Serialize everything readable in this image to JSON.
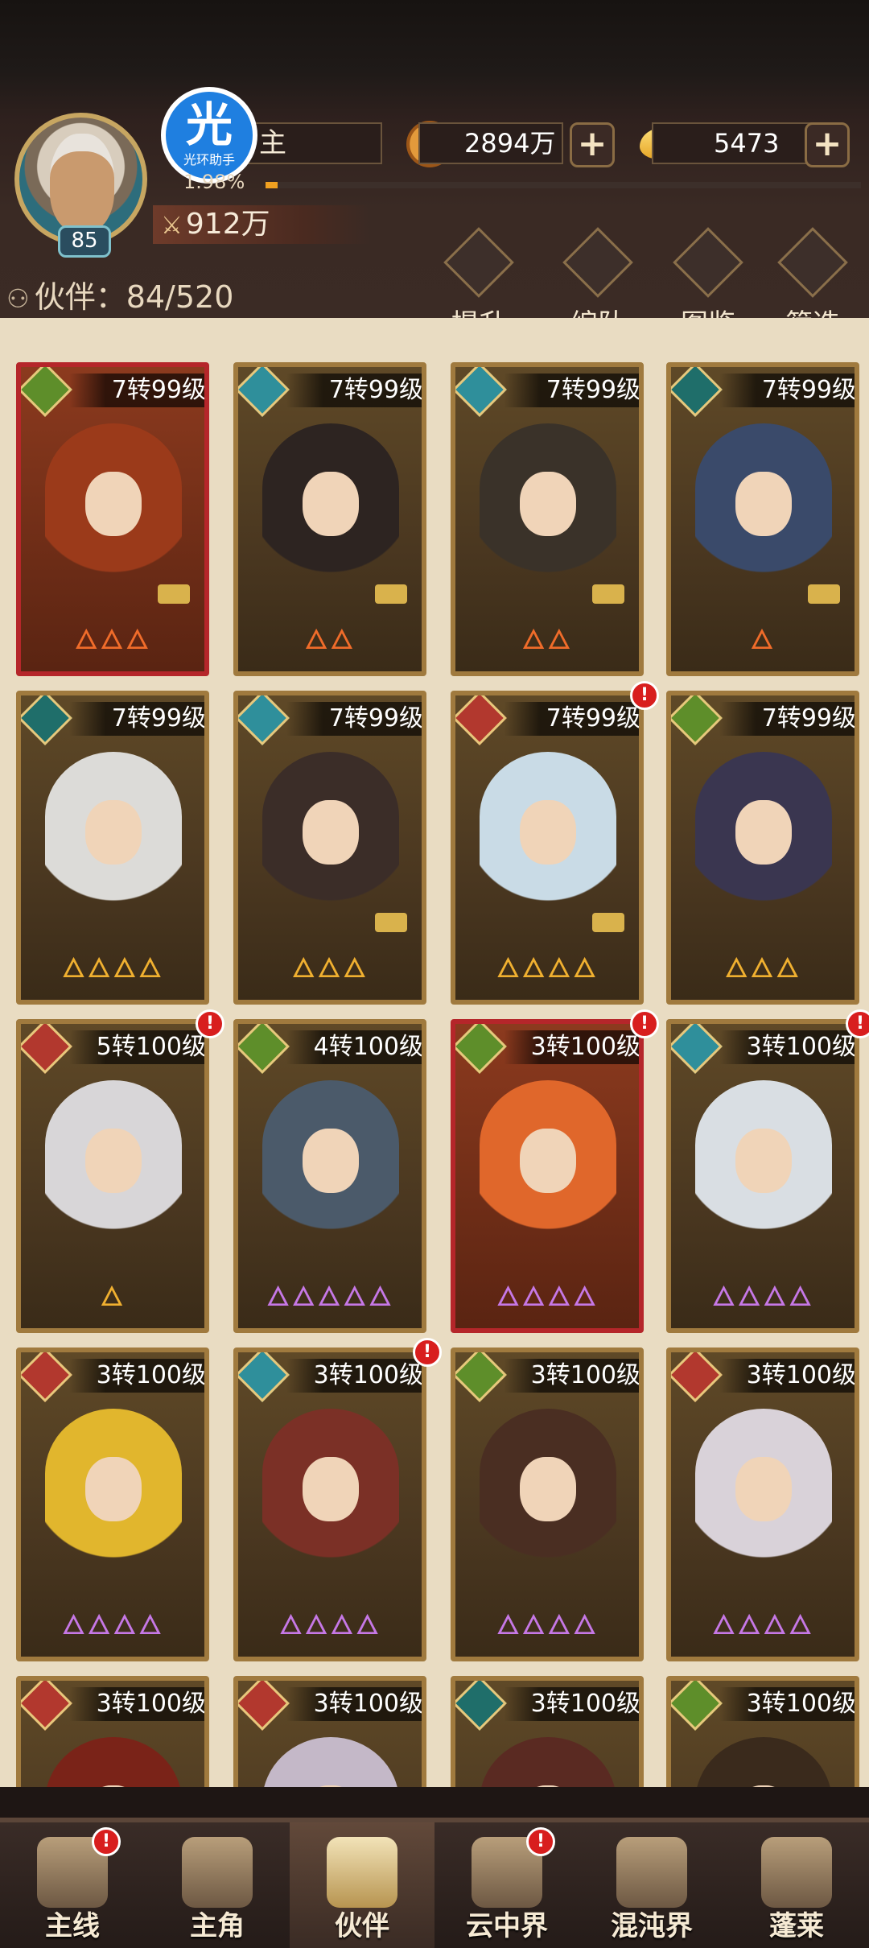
{
  "header": {
    "player_name": "主",
    "level": "85",
    "exp_percent": "1.98%",
    "exp_fraction": 0.0198,
    "power": "912万",
    "coins": "2894万",
    "gold": "5473",
    "helper_glyph": "光",
    "helper_label": "光环助手",
    "companions_label": "伙伴：84/520",
    "tools": [
      {
        "label": "提升",
        "icon": "upgrade-icon"
      },
      {
        "label": "编队",
        "icon": "formation-flag-icon"
      },
      {
        "label": "图鉴",
        "icon": "codex-scroll-icon"
      },
      {
        "label": "筛选",
        "icon": "filter-icon"
      }
    ]
  },
  "cards": [
    {
      "rank": "7转99级",
      "frame": "red",
      "stars": "🜂🜂🜂",
      "star_color": "orange",
      "star_count": 3,
      "locked": true,
      "alert": false,
      "element_color": "#5e8e2a",
      "art": "#9b3a1a"
    },
    {
      "rank": "7转99级",
      "frame": "gold",
      "stars": "🜂🜂",
      "star_color": "orange",
      "star_count": 2,
      "locked": true,
      "alert": false,
      "element_color": "#2f8f9b",
      "art": "#2d2421"
    },
    {
      "rank": "7转99级",
      "frame": "gold",
      "stars": "🜂🜂",
      "star_color": "orange",
      "star_count": 2,
      "locked": true,
      "alert": false,
      "element_color": "#2f8f9b",
      "art": "#3a3229"
    },
    {
      "rank": "7转99级",
      "frame": "gold",
      "stars": "🜂",
      "star_color": "orange",
      "star_count": 1,
      "locked": true,
      "alert": false,
      "element_color": "#1f6e6a",
      "art": "#3a4a6a"
    },
    {
      "rank": "7转99级",
      "frame": "gold",
      "stars": "🜂🜂🜂🜂",
      "star_color": "gold",
      "star_count": 4,
      "locked": false,
      "alert": false,
      "element_color": "#1f6e6a",
      "art": "#dcdbd8"
    },
    {
      "rank": "7转99级",
      "frame": "gold",
      "stars": "🜂🜂🜂",
      "star_color": "gold",
      "star_count": 3,
      "locked": true,
      "alert": false,
      "element_color": "#2f8f9b",
      "art": "#3b2d28"
    },
    {
      "rank": "7转99级",
      "frame": "gold",
      "stars": "🜂🜂🜂🜂",
      "star_color": "gold",
      "star_count": 4,
      "locked": true,
      "alert": true,
      "element_color": "#b2382e",
      "art": "#c9dbe6"
    },
    {
      "rank": "7转99级",
      "frame": "gold",
      "stars": "🜂🜂🜂",
      "star_color": "gold",
      "star_count": 3,
      "locked": false,
      "alert": false,
      "element_color": "#5e8e2a",
      "art": "#3a3650"
    },
    {
      "rank": "5转100级",
      "frame": "gold",
      "stars": "🜂",
      "star_color": "gold",
      "star_count": 1,
      "locked": false,
      "alert": true,
      "element_color": "#b2382e",
      "art": "#d8d6d8"
    },
    {
      "rank": "4转100级",
      "frame": "gold",
      "stars": "🜂🜂🜂🜂🜂",
      "star_color": "purple",
      "star_count": 5,
      "locked": false,
      "alert": false,
      "element_color": "#5e8e2a",
      "art": "#4b5a6a"
    },
    {
      "rank": "3转100级",
      "frame": "red",
      "stars": "🜂🜂🜂🜂",
      "star_color": "purple",
      "star_count": 4,
      "locked": false,
      "alert": true,
      "element_color": "#5e8e2a",
      "art": "#e0672b"
    },
    {
      "rank": "3转100级",
      "frame": "gold",
      "stars": "🜂🜂🜂🜂",
      "star_color": "purple",
      "star_count": 4,
      "locked": false,
      "alert": true,
      "element_color": "#2f8f9b",
      "art": "#d9dee3"
    },
    {
      "rank": "3转100级",
      "frame": "gold",
      "stars": "🜂🜂🜂🜂",
      "star_color": "purple",
      "star_count": 4,
      "locked": false,
      "alert": false,
      "element_color": "#b2382e",
      "art": "#e1b62d"
    },
    {
      "rank": "3转100级",
      "frame": "gold",
      "stars": "🜂🜂🜂🜂",
      "star_color": "purple",
      "star_count": 4,
      "locked": false,
      "alert": true,
      "element_color": "#2f8f9b",
      "art": "#7b3026"
    },
    {
      "rank": "3转100级",
      "frame": "gold",
      "stars": "🜂🜂🜂🜂",
      "star_color": "purple",
      "star_count": 4,
      "locked": false,
      "alert": false,
      "element_color": "#5e8e2a",
      "art": "#4a2e22"
    },
    {
      "rank": "3转100级",
      "frame": "gold",
      "stars": "🜂🜂🜂🜂",
      "star_color": "purple",
      "star_count": 4,
      "locked": false,
      "alert": false,
      "element_color": "#b2382e",
      "art": "#d9d2d9"
    },
    {
      "rank": "3转100级",
      "frame": "gold",
      "stars": "",
      "star_color": "purple",
      "star_count": 0,
      "locked": false,
      "alert": false,
      "element_color": "#b2382e",
      "art": "#7a2318"
    },
    {
      "rank": "3转100级",
      "frame": "gold",
      "stars": "",
      "star_color": "purple",
      "star_count": 0,
      "locked": false,
      "alert": false,
      "element_color": "#b2382e",
      "art": "#c4b8c8"
    },
    {
      "rank": "3转100级",
      "frame": "gold",
      "stars": "",
      "star_color": "purple",
      "star_count": 0,
      "locked": false,
      "alert": false,
      "element_color": "#1f6e6a",
      "art": "#5a2a22"
    },
    {
      "rank": "3转100级",
      "frame": "gold",
      "stars": "",
      "star_color": "purple",
      "star_count": 0,
      "locked": false,
      "alert": false,
      "element_color": "#5e8e2a",
      "art": "#3a2a1c"
    }
  ],
  "nav": [
    {
      "label": "主线",
      "name": "nav-main-quest",
      "alert": true,
      "active": false
    },
    {
      "label": "主角",
      "name": "nav-protagonist",
      "alert": false,
      "active": false
    },
    {
      "label": "伙伴",
      "name": "nav-companions",
      "alert": false,
      "active": true
    },
    {
      "label": "云中界",
      "name": "nav-cloud-realm",
      "alert": true,
      "active": false
    },
    {
      "label": "混沌界",
      "name": "nav-chaos-realm",
      "alert": false,
      "active": false
    },
    {
      "label": "蓬莱",
      "name": "nav-penglai",
      "alert": false,
      "active": false
    }
  ],
  "alert_symbol": "!"
}
